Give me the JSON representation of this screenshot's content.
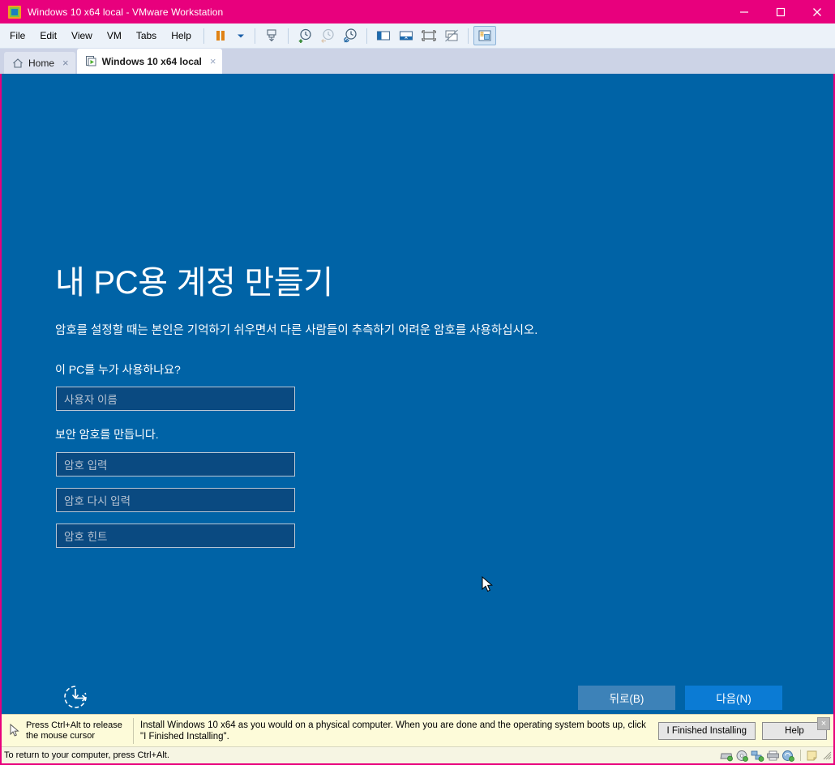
{
  "window": {
    "title": "Windows 10 x64 local - VMware Workstation",
    "app_icon": "vmware-logo-icon",
    "minimize": "minimize-icon",
    "maximize": "maximize-icon",
    "close": "close-icon",
    "accent_color": "#e8007d"
  },
  "menubar": {
    "items": [
      {
        "label": "File"
      },
      {
        "label": "Edit"
      },
      {
        "label": "View"
      },
      {
        "label": "VM"
      },
      {
        "label": "Tabs"
      },
      {
        "label": "Help"
      }
    ]
  },
  "toolbar": {
    "buttons": [
      {
        "name": "suspend-icon",
        "title": "Suspend"
      },
      {
        "name": "chevron-down-icon",
        "title": "Power options"
      },
      {
        "name": "manage-snapshots-icon",
        "title": "Manage"
      },
      {
        "name": "take-snapshot-icon",
        "title": "Take snapshot"
      },
      {
        "name": "revert-snapshot-icon",
        "title": "Revert to snapshot"
      },
      {
        "name": "snapshot-manager-icon",
        "title": "Snapshot manager"
      },
      {
        "name": "show-library-icon",
        "title": "Show or hide the Library"
      },
      {
        "name": "console-view-icon",
        "title": "Console view"
      },
      {
        "name": "fullscreen-icon",
        "title": "Enter full screen"
      },
      {
        "name": "unity-mode-icon",
        "title": "Unity mode"
      },
      {
        "name": "show-thumbnails-icon",
        "title": "Show or hide thumbnail bar"
      }
    ]
  },
  "tabs": [
    {
      "label": "Home",
      "icon": "home-icon",
      "active": false,
      "close": "×"
    },
    {
      "label": "Windows 10 x64 local",
      "icon": "vm-tab-icon",
      "active": true,
      "close": "×"
    }
  ],
  "vm_screen": {
    "background_color": "#0063a6",
    "oobe": {
      "heading": "내 PC용 계정 만들기",
      "subtitle": "암호를 설정할 때는 본인은 기억하기 쉬우면서 다른 사람들이 추측하기 어려운 암호를 사용하십시오.",
      "user_label": "이 PC를 누가 사용하나요?",
      "password_label": "보안 암호를 만듭니다.",
      "fields": [
        {
          "name": "username-input",
          "placeholder": "사용자 이름",
          "value": ""
        },
        {
          "name": "password-input",
          "placeholder": "암호 입력",
          "value": ""
        },
        {
          "name": "password-confirm-input",
          "placeholder": "암호 다시 입력",
          "value": ""
        },
        {
          "name": "password-hint-input",
          "placeholder": "암호 힌트",
          "value": ""
        }
      ],
      "back_button": "뒤로(B)",
      "next_button": "다음(N)",
      "ease_of_access_icon": "ease-of-access-icon",
      "accent_button_color": "#0b7bd4",
      "secondary_button_color": "#3d82b8"
    }
  },
  "hintbar": {
    "release_text": "Press Ctrl+Alt to release the mouse cursor",
    "message": "Install Windows 10 x64 as you would on a physical computer. When you are done and the operating system boots up, click \"I Finished Installing\".",
    "finished_button": "I Finished Installing",
    "help_button": "Help",
    "close": "×",
    "background_color": "#fdfbd9"
  },
  "statusbar": {
    "text": "To return to your computer, press Ctrl+Alt.",
    "devices": [
      {
        "name": "hard-disk-icon"
      },
      {
        "name": "cd-dvd-icon"
      },
      {
        "name": "network-adapter-icon"
      },
      {
        "name": "printer-icon"
      },
      {
        "name": "sound-card-icon"
      },
      {
        "name": "notes-icon"
      }
    ]
  }
}
